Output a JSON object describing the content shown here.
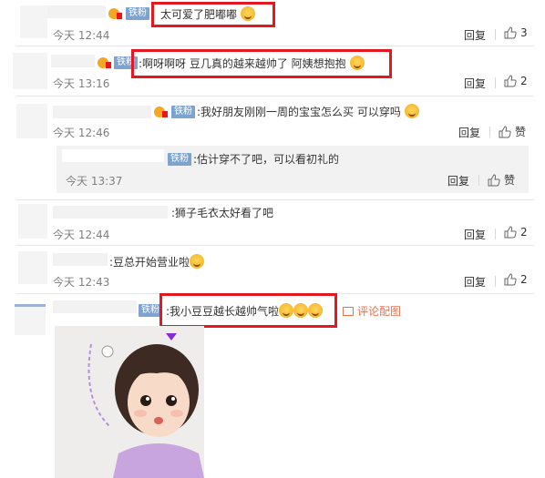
{
  "fan_badge": "铁粉",
  "reply_label": "回复",
  "like_label": "赞",
  "comments": [
    {
      "text": "太可爱了肥嘟嘟",
      "time": "今天 12:44",
      "likes": "3"
    },
    {
      "text": ":啊呀啊呀  豆几真的越来越帅了 阿姨想抱抱",
      "time": "今天 13:16",
      "likes": "2"
    },
    {
      "text": ":我好朋友刚刚一周的宝宝怎么买 可以穿吗",
      "time": "今天 12:46",
      "likes": "赞"
    },
    {
      "text": ":估计穿不了吧，可以看初礼的",
      "time": "今天 13:37",
      "likes": "赞"
    },
    {
      "text": ":狮子毛衣太好看了吧",
      "time": "今天 12:44",
      "likes": "2"
    },
    {
      "text": ":豆总开始营业啦",
      "time": "今天 12:43",
      "likes": "2"
    },
    {
      "text": ":我小豆豆越长越帅气啦",
      "time": "",
      "likes": ""
    }
  ],
  "comment_pic_label": "评论配图",
  "colors": {
    "highlight": "#e5171f",
    "fan_badge": "#7fa3cf",
    "pic_link": "#eb7350"
  }
}
